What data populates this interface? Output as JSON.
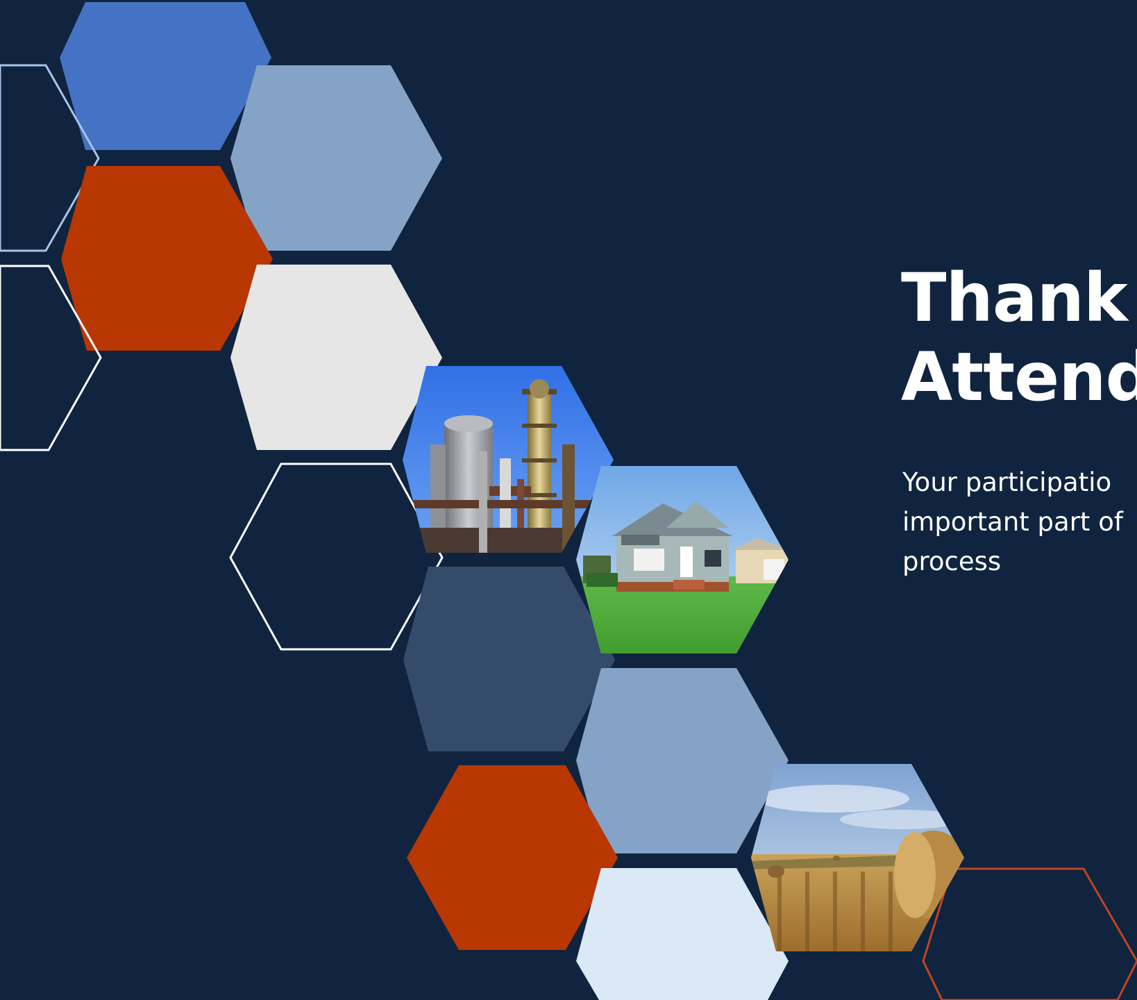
{
  "slide": {
    "title_lines": [
      "Thank Y",
      "Attendi"
    ],
    "subtitle_lines": [
      "Your participatio",
      "important part of",
      "process"
    ]
  },
  "colors": {
    "background": "#10243f",
    "accent_blue": "#4472c4",
    "light_steel_blue": "#85a3c6",
    "burnt_orange": "#b83703",
    "light_gray": "#e6e6e6",
    "slate_blue": "#344c6a",
    "pale_blue": "#dbe9f7",
    "outline_light_blue": "#a9c4eb",
    "outline_white": "#ffffff",
    "outline_orange": "#c0451f"
  },
  "hexagons": [
    {
      "name": "hex-accent-blue-top",
      "fill": "accent_blue"
    },
    {
      "name": "hex-outline-left-upper",
      "stroke": "outline_light_blue"
    },
    {
      "name": "hex-steel-blue-upper",
      "fill": "light_steel_blue"
    },
    {
      "name": "hex-orange-upper",
      "fill": "burnt_orange"
    },
    {
      "name": "hex-outline-left-lower",
      "stroke": "outline_white"
    },
    {
      "name": "hex-light-gray",
      "fill": "light_gray"
    },
    {
      "name": "hex-outline-white-center",
      "stroke": "outline_white"
    },
    {
      "name": "hex-slate-blue",
      "fill": "slate_blue"
    },
    {
      "name": "hex-steel-blue-lower",
      "fill": "light_steel_blue"
    },
    {
      "name": "hex-orange-lower",
      "fill": "burnt_orange"
    },
    {
      "name": "hex-pale-blue-bottom",
      "fill": "pale_blue"
    },
    {
      "name": "hex-outline-orange-bottom",
      "stroke": "outline_orange"
    }
  ],
  "photos": [
    {
      "name": "industrial-plant-photo",
      "subject": "refinery towers against blue sky"
    },
    {
      "name": "house-photo",
      "subject": "gray house with green lawn"
    },
    {
      "name": "farm-field-photo",
      "subject": "hay bales in harvested field"
    }
  ]
}
